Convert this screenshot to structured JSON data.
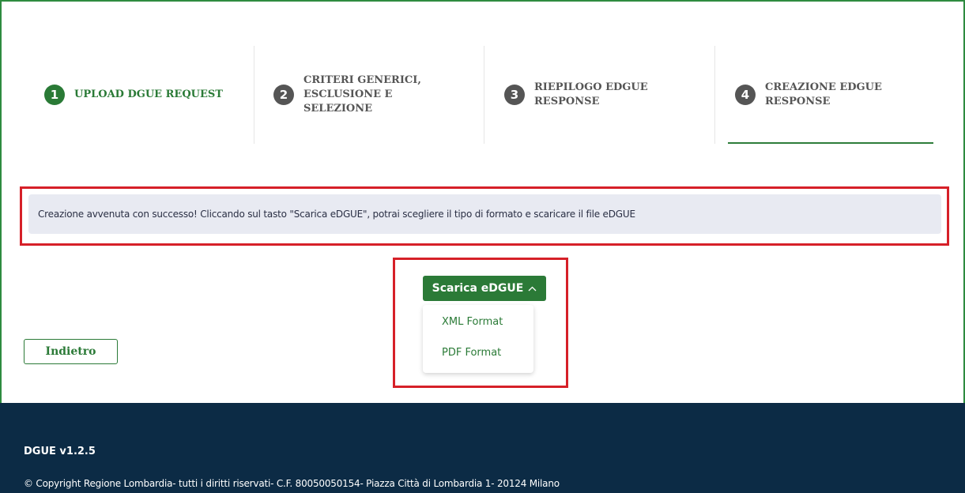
{
  "stepper": {
    "steps": [
      {
        "number": "1",
        "label": "UPLOAD DGUE REQUEST",
        "state": "active"
      },
      {
        "number": "2",
        "label": "CRITERI GENERICI, ESCLUSIONE E SELEZIONE",
        "state": "inactive"
      },
      {
        "number": "3",
        "label": "RIEPILOGO EDGUE RESPONSE",
        "state": "inactive"
      },
      {
        "number": "4",
        "label": "CREAZIONE EDGUE RESPONSE",
        "state": "current"
      }
    ]
  },
  "alert": {
    "message": "Creazione avvenuta con successo! Cliccando sul tasto \"Scarica eDGUE\", potrai scegliere il tipo di formato e scaricare il file eDGUE"
  },
  "download": {
    "button_label": "Scarica eDGUE",
    "chevron_icon": "chevron-up-icon",
    "options": [
      "XML Format",
      "PDF Format"
    ]
  },
  "actions": {
    "back_label": "Indietro"
  },
  "footer": {
    "version": "DGUE v1.2.5",
    "copyright": "© Copyright Regione Lombardia- tutti i diritti riservati- C.F. 80050050154- Piazza Città di Lombardia 1- 20124 Milano"
  },
  "colors": {
    "accent_green": "#2b7a37",
    "highlight_red": "#d62028",
    "footer_bg": "#0c2b45",
    "alert_bg": "#e8eaf2"
  }
}
